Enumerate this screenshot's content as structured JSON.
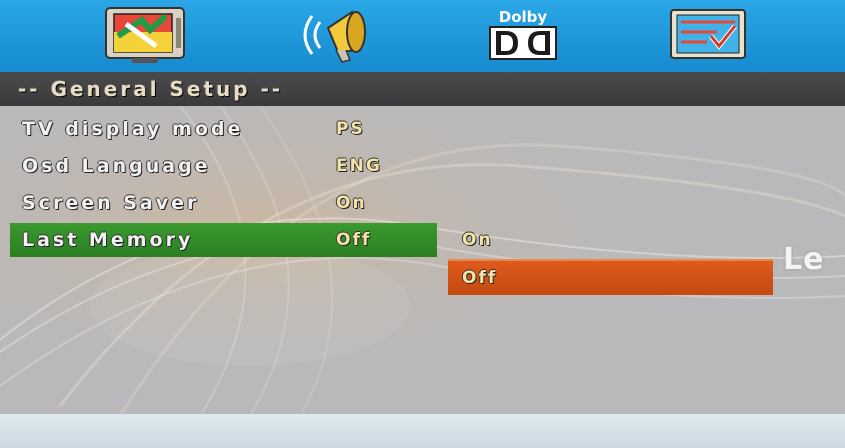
{
  "top_tabs": [
    {
      "icon": "tv-setup-icon"
    },
    {
      "icon": "speaker-audio-icon"
    },
    {
      "icon": "dolby-icon",
      "label": "Dolby"
    },
    {
      "icon": "preference-check-icon"
    }
  ],
  "section": {
    "title": "-- General Setup --"
  },
  "menu": [
    {
      "label": "TV display mode",
      "value": "PS"
    },
    {
      "label": "Osd Language",
      "value": "ENG"
    },
    {
      "label": "Screen Saver",
      "value": "On"
    },
    {
      "label": "Last Memory",
      "value": "Off"
    }
  ],
  "submenu": [
    {
      "label": "On"
    },
    {
      "label": "Off"
    }
  ],
  "brand_partial": "Le",
  "colors": {
    "topbar": "#1d97db",
    "selected_row": "#33902a",
    "highlight_option": "#d4521a",
    "value_text": "#f3e3a7"
  }
}
